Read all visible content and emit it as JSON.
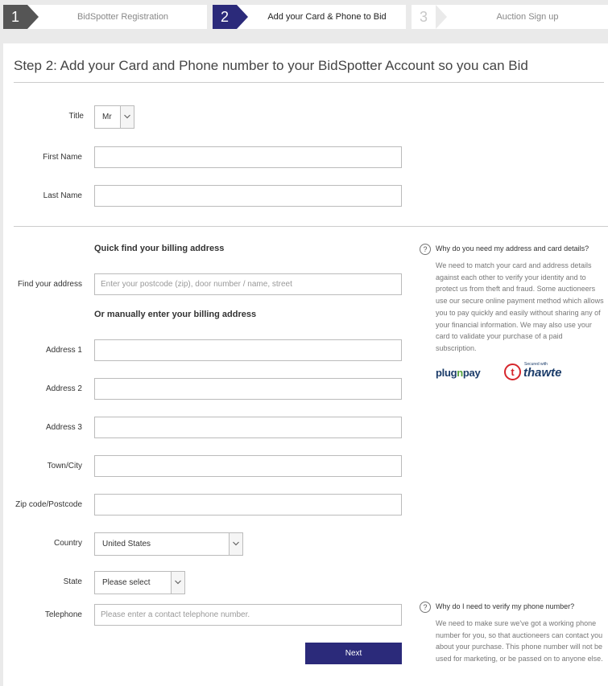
{
  "stepper": {
    "steps": [
      {
        "number": "1",
        "label": "BidSpotter Registration"
      },
      {
        "number": "2",
        "label": "Add your Card & Phone to Bid"
      },
      {
        "number": "3",
        "label": "Auction Sign up"
      }
    ]
  },
  "page": {
    "title": "Step 2: Add your Card and Phone number to your BidSpotter Account so you can Bid"
  },
  "form": {
    "title": {
      "label": "Title",
      "value": "Mr"
    },
    "first_name": {
      "label": "First Name",
      "value": ""
    },
    "last_name": {
      "label": "Last Name",
      "value": ""
    },
    "quick_find_heading": "Quick find your billing address",
    "find_address": {
      "label": "Find your address",
      "placeholder": "Enter your postcode (zip), door number / name, street"
    },
    "manual_heading": "Or manually enter your billing address",
    "address1": {
      "label": "Address 1",
      "value": ""
    },
    "address2": {
      "label": "Address 2",
      "value": ""
    },
    "address3": {
      "label": "Address 3",
      "value": ""
    },
    "town": {
      "label": "Town/City",
      "value": ""
    },
    "zip": {
      "label": "Zip code/Postcode",
      "value": ""
    },
    "country": {
      "label": "Country",
      "value": "United States"
    },
    "state": {
      "label": "State",
      "value": "Please select"
    },
    "telephone": {
      "label": "Telephone",
      "placeholder": "Please enter a contact telephone number."
    },
    "next_label": "Next"
  },
  "help": {
    "address": {
      "icon": "?",
      "title": "Why do you need my address and card details?",
      "body": "We need to match your card and address details against each other to verify your identity and to protect us from theft and fraud. Some auctioneers use our secure online payment method which allows you to pay quickly and easily without sharing any of your financial information. We may also use your card to validate your purchase of a paid subscription."
    },
    "phone": {
      "icon": "?",
      "title": "Why do I need to verify my phone number?",
      "body": "We need to make sure we've got a working phone number for you, so that auctioneers can contact you about your purchase. This phone number will not be used for marketing, or be passed on to anyone else."
    }
  },
  "logos": {
    "plugnpay": {
      "pre": "plug",
      "mid": "n",
      "post": "pay"
    },
    "thawte": {
      "letter": "t",
      "secured": "Secured with",
      "word": "thawte"
    }
  },
  "colors": {
    "accent": "#2b2a7a",
    "step_inactive": "#555555",
    "background": "#eaeaea"
  }
}
